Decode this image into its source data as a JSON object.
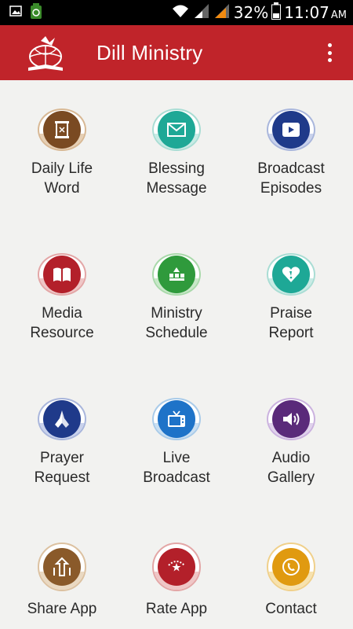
{
  "status_bar": {
    "battery_percent": "32%",
    "time": "11:07",
    "ampm": "AM",
    "icons": [
      "gallery-icon",
      "battery-saver-icon",
      "wifi-icon",
      "signal-icon",
      "signal-icon",
      "battery-icon"
    ]
  },
  "app_bar": {
    "title": "Dill Ministry",
    "logo": "dill-ministry-logo",
    "menu_icon": "overflow-menu-icon"
  },
  "tiles": [
    {
      "label": "Daily Life\nWord",
      "icon": "scroll-icon",
      "color": "#7a4a22",
      "ring": "#c9a27a"
    },
    {
      "label": "Blessing\nMessage",
      "icon": "envelope-icon",
      "color": "#1ea896",
      "ring": "#9fd9cf"
    },
    {
      "label": "Broadcast\nEpisodes",
      "icon": "video-icon",
      "color": "#1f3a8a",
      "ring": "#9aaad6"
    },
    {
      "label": "Media\nResource",
      "icon": "book-icon",
      "color": "#b3202a",
      "ring": "#e09a9a"
    },
    {
      "label": "Ministry\nSchedule",
      "icon": "calendar-icon",
      "color": "#2f9a3c",
      "ring": "#9fd6a0"
    },
    {
      "label": "Praise\nReport",
      "icon": "heart-icon",
      "color": "#1ea896",
      "ring": "#9fd9cf"
    },
    {
      "label": "Prayer\nRequest",
      "icon": "praying-hands-icon",
      "color": "#1f3a8a",
      "ring": "#9aaad6"
    },
    {
      "label": "Live\nBroadcast",
      "icon": "tv-icon",
      "color": "#1e73c8",
      "ring": "#9fc3e8"
    },
    {
      "label": "Audio\nGallery",
      "icon": "speaker-icon",
      "color": "#5a2a7a",
      "ring": "#c2a4d8"
    },
    {
      "label": "Share App",
      "icon": "share-icon",
      "color": "#8a5a2a",
      "ring": "#d6b890"
    },
    {
      "label": "Rate App",
      "icon": "star-badge-icon",
      "color": "#b3202a",
      "ring": "#e09a9a"
    },
    {
      "label": "Contact",
      "icon": "phone-icon",
      "color": "#e09a10",
      "ring": "#f2cf80"
    }
  ]
}
